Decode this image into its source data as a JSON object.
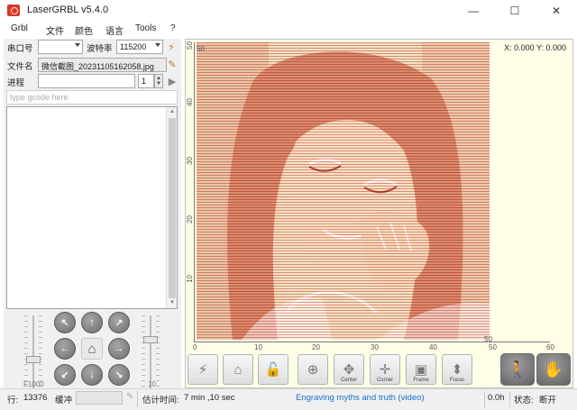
{
  "window": {
    "title": "LaserGRBL v5.4.0",
    "minimize": "—",
    "maximize": "☐",
    "close": "✕"
  },
  "menu": [
    "Grbl",
    "文件",
    "颜色",
    "语言",
    "Tools",
    "?"
  ],
  "connection": {
    "port_label": "串口号",
    "port_value": "",
    "baud_label": "波特率",
    "baud_value": "115200"
  },
  "file": {
    "label": "文件名",
    "value": "微信截图_20231105162058.jpg"
  },
  "progress": {
    "label": "进程",
    "passes": "1",
    "fraction": 0
  },
  "gcode_input": {
    "placeholder": "type gcode here"
  },
  "jog": {
    "speed_label": "F1000",
    "step_label": "10",
    "speed_level": 0.55,
    "step_level": 0.28
  },
  "preview": {
    "coordinates": "X: 0.000 Y: 0.000",
    "x_ticks": [
      "0",
      "10",
      "20",
      "30",
      "40",
      "50",
      "60"
    ],
    "y_ticks": [
      "10",
      "20",
      "30",
      "40",
      "50"
    ],
    "top_left_tick": "50",
    "right_tick": "50"
  },
  "toolbar": {
    "buttons": [
      {
        "name": "laser-button",
        "icon": "⚡",
        "caption": ""
      },
      {
        "name": "home-button",
        "icon": "⌂",
        "caption": ""
      },
      {
        "name": "unlock-button",
        "icon": "🔓",
        "caption": ""
      },
      {
        "name": "set-origin-button",
        "icon": "⊕",
        "caption": ""
      },
      {
        "name": "center-button",
        "icon": "✥",
        "caption": "Center"
      },
      {
        "name": "corner-button",
        "icon": "✛",
        "caption": "Corner"
      },
      {
        "name": "frame-button",
        "icon": "▣",
        "caption": "Frame"
      },
      {
        "name": "focus-button",
        "icon": "⬍",
        "caption": "Focus"
      }
    ],
    "walk_icon": "🚶",
    "stop_icon": "✋"
  },
  "status": {
    "rows_label": "行:",
    "rows_value": "13376",
    "buffer_label": "缓冲",
    "time_label": "估计时间:",
    "time_value": "7 min ,10 sec",
    "link": "Engraving myths and truth (video)",
    "hours": "0.0h",
    "state_label": "状态:",
    "state_value": "断开"
  },
  "colors": {
    "accent": "#1a6fd0",
    "engrave": "#cc5a44",
    "canvas": "#ffffe8"
  }
}
